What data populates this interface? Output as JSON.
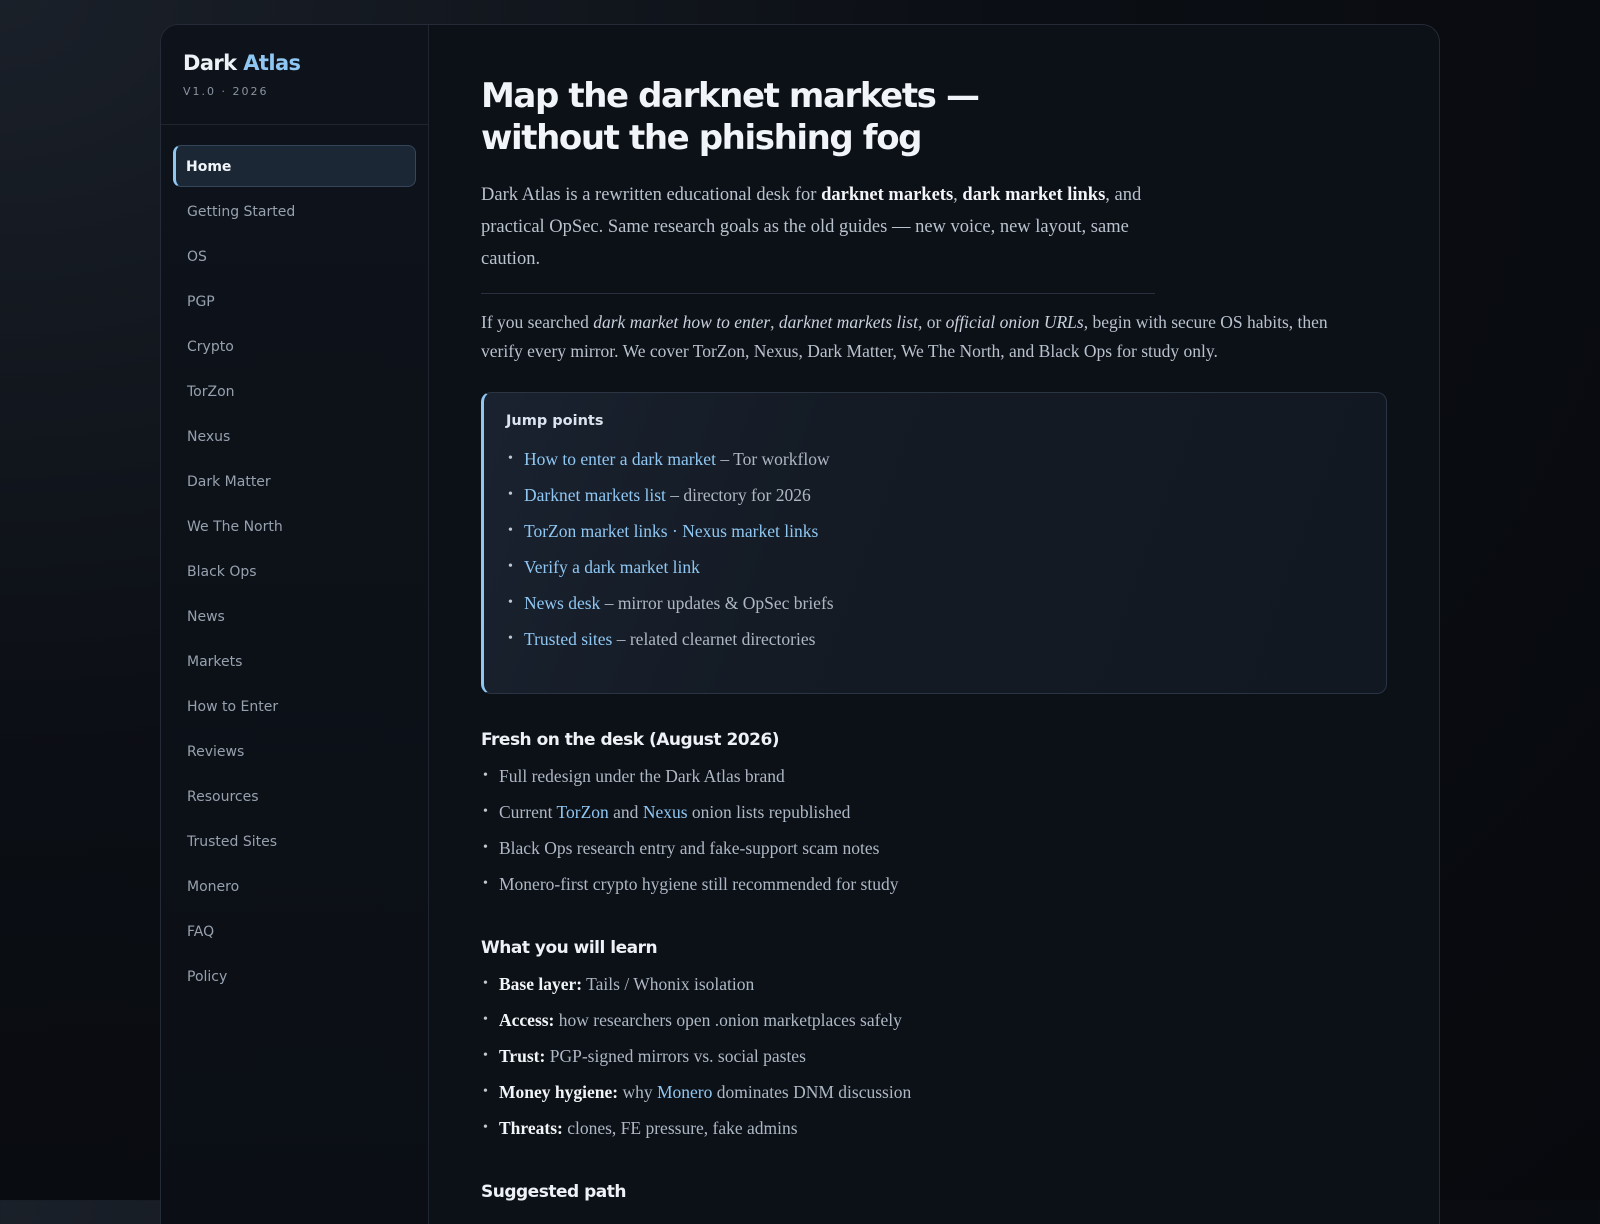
{
  "brand": {
    "name": "Dark",
    "accent": "Atlas",
    "version": "V1.0 · 2026"
  },
  "nav": [
    "Home",
    "Getting Started",
    "OS",
    "PGP",
    "Crypto",
    "TorZon",
    "Nexus",
    "Dark Matter",
    "We The North",
    "Black Ops",
    "News",
    "Markets",
    "How to Enter",
    "Reviews",
    "Resources",
    "Trusted Sites",
    "Monero",
    "FAQ",
    "Policy"
  ],
  "hero": {
    "title": "Map the darknet markets — without the phishing fog",
    "lead_1": "Dark Atlas is a rewritten educational desk for ",
    "lead_b1": "darknet markets",
    "lead_2": ", ",
    "lead_b2": "dark market links",
    "lead_3": ", and practical OpSec. Same research goals as the old guides — new voice, new layout, same caution."
  },
  "intro": {
    "p1": "If you searched ",
    "i1": "dark market how to enter",
    "p2": ", ",
    "i2": "darknet markets list",
    "p3": ", or ",
    "i3": "official onion URLs",
    "p4": ", begin with secure OS habits, then verify every mirror. We cover TorZon, Nexus, Dark Matter, We The North, and Black Ops for study only."
  },
  "jump": {
    "title": "Jump points",
    "items": [
      {
        "link": "How to enter a dark market",
        "rest": " – Tor workflow"
      },
      {
        "link": "Darknet markets list",
        "rest": " – directory for 2026"
      },
      {
        "link": "TorZon market links",
        "sep": " · ",
        "link2": "Nexus market links"
      },
      {
        "link": "Verify a dark market link"
      },
      {
        "link": "News desk",
        "rest": " – mirror updates & OpSec briefs"
      },
      {
        "link": "Trusted sites",
        "rest": " – related clearnet directories"
      }
    ]
  },
  "fresh": {
    "title": "Fresh on the desk (August 2026)",
    "i1": "Full redesign under the Dark Atlas brand",
    "i2_a": "Current ",
    "i2_l1": "TorZon",
    "i2_b": " and ",
    "i2_l2": "Nexus",
    "i2_c": " onion lists republished",
    "i3": "Black Ops research entry and fake-support scam notes",
    "i4": "Monero-first crypto hygiene still recommended for study"
  },
  "learn": {
    "title": "What you will learn",
    "items": [
      {
        "label": "Base layer:",
        "text": " Tails / Whonix isolation"
      },
      {
        "label": "Access:",
        "text": " how researchers open .onion marketplaces safely"
      },
      {
        "label": "Trust:",
        "text": " PGP-signed mirrors vs. social pastes"
      },
      {
        "label": "Money hygiene:",
        "text": " why ",
        "link": "Monero",
        "text2": " dominates DNM discussion"
      },
      {
        "label": "Threats:",
        "text": " clones, FE pressure, fake admins"
      }
    ]
  },
  "path": {
    "title": "Suggested path"
  },
  "colors": {
    "accent": "#8fc7f2",
    "background": "#0b0e14",
    "panel": "#0c1017"
  }
}
